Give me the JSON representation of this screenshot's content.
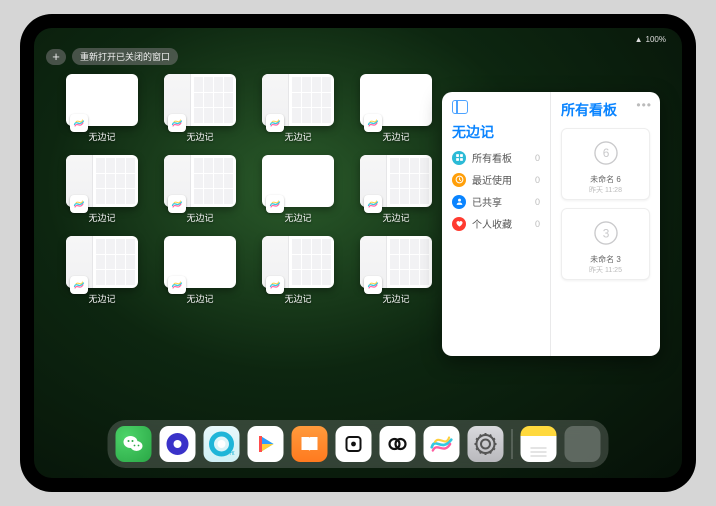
{
  "status": {
    "wifi": "􀙇",
    "battery": "100%"
  },
  "top": {
    "plus": "+",
    "reopen_label": "重新打开已关闭的窗口"
  },
  "app_switcher": {
    "tile_label": "无边记",
    "tiles": [
      {
        "variant": "blank"
      },
      {
        "variant": "detail"
      },
      {
        "variant": "detail"
      },
      {
        "variant": "blank"
      },
      {
        "variant": "detail"
      },
      {
        "variant": "detail"
      },
      {
        "variant": "blank"
      },
      {
        "variant": "detail"
      },
      {
        "variant": "detail"
      },
      {
        "variant": "blank"
      },
      {
        "variant": "detail"
      },
      {
        "variant": "detail"
      }
    ]
  },
  "large_window": {
    "sidebar": {
      "title": "无边记",
      "items": [
        {
          "label": "所有看板",
          "count": 0,
          "color": "#2bbad6",
          "icon": "grid"
        },
        {
          "label": "最近使用",
          "count": 0,
          "color": "#ff9f0a",
          "icon": "clock"
        },
        {
          "label": "已共享",
          "count": 0,
          "color": "#0a84ff",
          "icon": "person"
        },
        {
          "label": "个人收藏",
          "count": 0,
          "color": "#ff3b30",
          "icon": "heart"
        }
      ]
    },
    "main": {
      "title": "所有看板",
      "ellipsis": "•••",
      "boards": [
        {
          "name": "未命名 6",
          "time": "昨天 11:28",
          "digit": "6"
        },
        {
          "name": "未命名 3",
          "time": "昨天 11:25",
          "digit": "3"
        }
      ]
    }
  },
  "dock": {
    "icons": [
      {
        "name": "wechat"
      },
      {
        "name": "browser-purple"
      },
      {
        "name": "browser-teal"
      },
      {
        "name": "video-player"
      },
      {
        "name": "books"
      },
      {
        "name": "dice-game"
      },
      {
        "name": "rings-app"
      },
      {
        "name": "freeform"
      },
      {
        "name": "settings"
      },
      {
        "name": "notes"
      },
      {
        "name": "app-folder"
      }
    ]
  }
}
